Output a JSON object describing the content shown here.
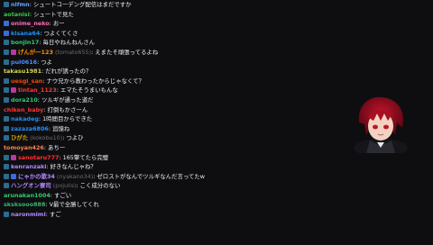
{
  "messages": [
    {
      "badges": [
        "wrench"
      ],
      "user": "nlfmn",
      "alt": "",
      "text": ": シュートコーデング配信はまだですか",
      "color": "#5fa7ff"
    },
    {
      "badges": [],
      "user": "aotanisi",
      "alt": "",
      "text": ": シュートで見た",
      "color": "#37c847"
    },
    {
      "badges": [
        "tv"
      ],
      "user": "onime_neko",
      "alt": "",
      "text": ": おー",
      "color": "#ff69b4"
    },
    {
      "badges": [
        "tv"
      ],
      "user": "kisana64",
      "alt": "",
      "text": ": つよくてくさ",
      "color": "#1e90ff"
    },
    {
      "badges": [
        "wrench"
      ],
      "user": "bonjin17",
      "alt": "",
      "text": ": 毎日やねんねんさん",
      "color": "#2ecc71"
    },
    {
      "badges": [
        "wrench",
        "gift"
      ],
      "user": "げんが一123",
      "alt": "(tomato655)",
      "text": ": えまたそ頑張ってるよね",
      "color": "#ff8c00"
    },
    {
      "badges": [
        "wrench"
      ],
      "user": "pul0616",
      "alt": "",
      "text": ": つよ",
      "color": "#4e8cff"
    },
    {
      "badges": [],
      "user": "takasu1981",
      "alt": "",
      "text": ": だれが誘ったの？",
      "color": "#d6d656"
    },
    {
      "badges": [
        "wrench"
      ],
      "user": "uesgi_san",
      "alt": "",
      "text": ": ナウ兄から教わったからじゃなくて？",
      "color": "#ff4500"
    },
    {
      "badges": [
        "wrench",
        "gift"
      ],
      "user": "tintan_1123",
      "alt": "",
      "text": ": エマたそうまいもんな",
      "color": "#ff3333"
    },
    {
      "badges": [
        "wrench"
      ],
      "user": "dora210",
      "alt": "",
      "text": ": ツルギが通った道だ",
      "color": "#2ecc71"
    },
    {
      "badges": [],
      "user": "chiken_baby",
      "alt": "",
      "text": ": 打倒もかさーん",
      "color": "#ff3333"
    },
    {
      "badges": [
        "wrench"
      ],
      "user": "nakadeg",
      "alt": "",
      "text": ": 1時間目からできた",
      "color": "#1e90ff"
    },
    {
      "badges": [
        "wrench"
      ],
      "user": "zazaza6806",
      "alt": "",
      "text": ": 追憶ね",
      "color": "#1e90ff"
    },
    {
      "badges": [
        "wrench"
      ],
      "user": "ひがた",
      "alt": "(kokobu10)",
      "text": ": つよひ",
      "color": "#d6a400"
    },
    {
      "badges": [],
      "user": "tomoyan426",
      "alt": "",
      "text": ": あちー",
      "color": "#ff7f50"
    },
    {
      "badges": [
        "wrench",
        "gift"
      ],
      "user": "sanotaru777",
      "alt": "",
      "text": ": 165擎てたら完璧",
      "color": "#ff3333"
    },
    {
      "badges": [
        "wrench"
      ],
      "user": "kenranzaki",
      "alt": "",
      "text": ": 好きなんじゃね？",
      "color": "#b388ff"
    },
    {
      "badges": [
        "wrench",
        "tv"
      ],
      "user": "にゃかの歌34",
      "alt": "(nyakano34)",
      "text": ": ゼロストがなんでツルギなんだ言ってたw",
      "color": "#b388ff"
    },
    {
      "badges": [
        "wrench"
      ],
      "user": "ハングオン寮司",
      "alt": "(pojulis)",
      "text": ": こく成分のない",
      "color": "#b388ff"
    },
    {
      "badges": [],
      "user": "arunakan1004",
      "alt": "",
      "text": ": すごい",
      "color": "#2ecc71"
    },
    {
      "badges": [],
      "user": "sksksooo888",
      "alt": "",
      "text": ": V最で全勝してくれ",
      "color": "#3cb371"
    },
    {
      "badges": [
        "wrench"
      ],
      "user": "naronmimi",
      "alt": "",
      "text": ": すご",
      "color": "#b388ff"
    }
  ]
}
